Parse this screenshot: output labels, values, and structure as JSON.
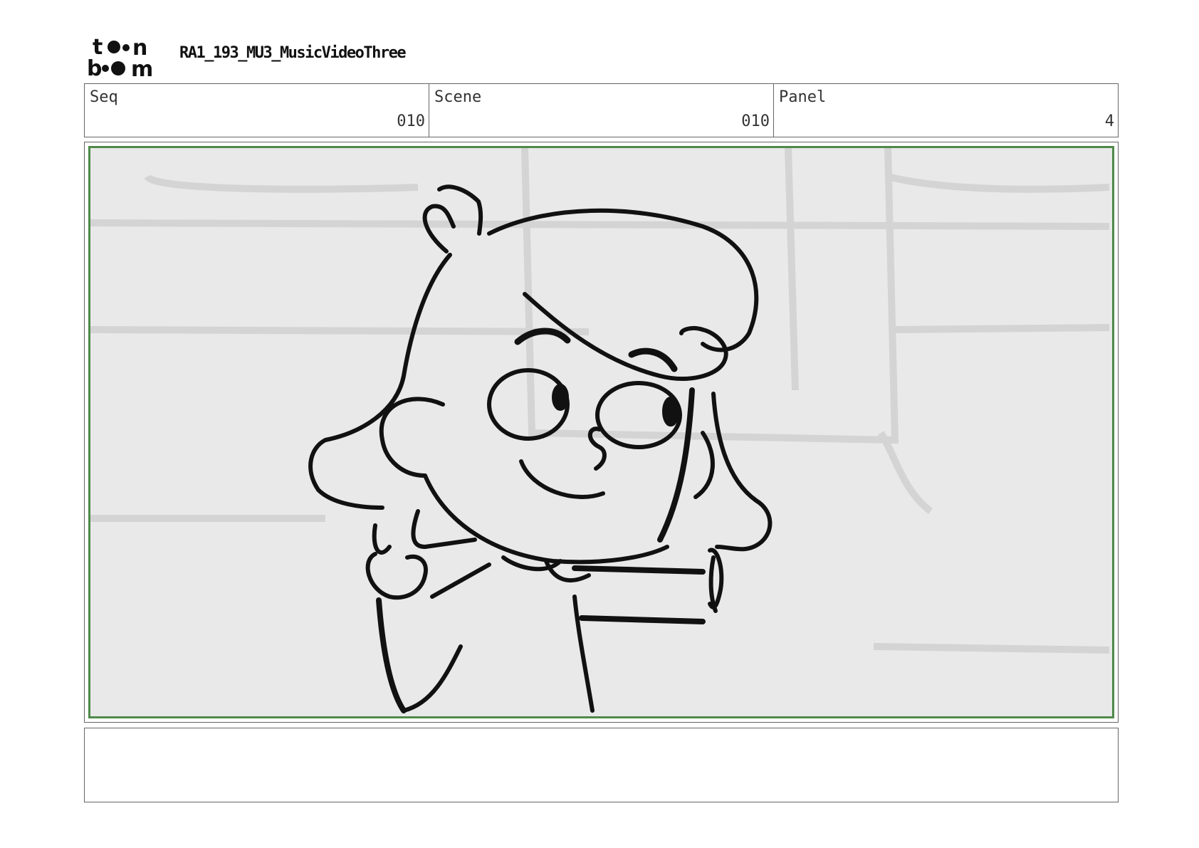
{
  "logo": {
    "line1": "t••n",
    "line2": "b••m",
    "icon": "toonboom-logo"
  },
  "document": {
    "title": "RA1_193_MU3_MusicVideoThree"
  },
  "header": {
    "seq": {
      "label": "Seq",
      "value": "010"
    },
    "scene": {
      "label": "Scene",
      "value": "010"
    },
    "panel": {
      "label": "Panel",
      "value": "4"
    }
  },
  "panel_image": {
    "description_icon": "storyboard-sketch-character"
  },
  "caption": {
    "text": ""
  },
  "colors": {
    "frame_border": "#666666",
    "image_border": "#4f8a4a",
    "sketch_background": "#e9e9e9"
  }
}
